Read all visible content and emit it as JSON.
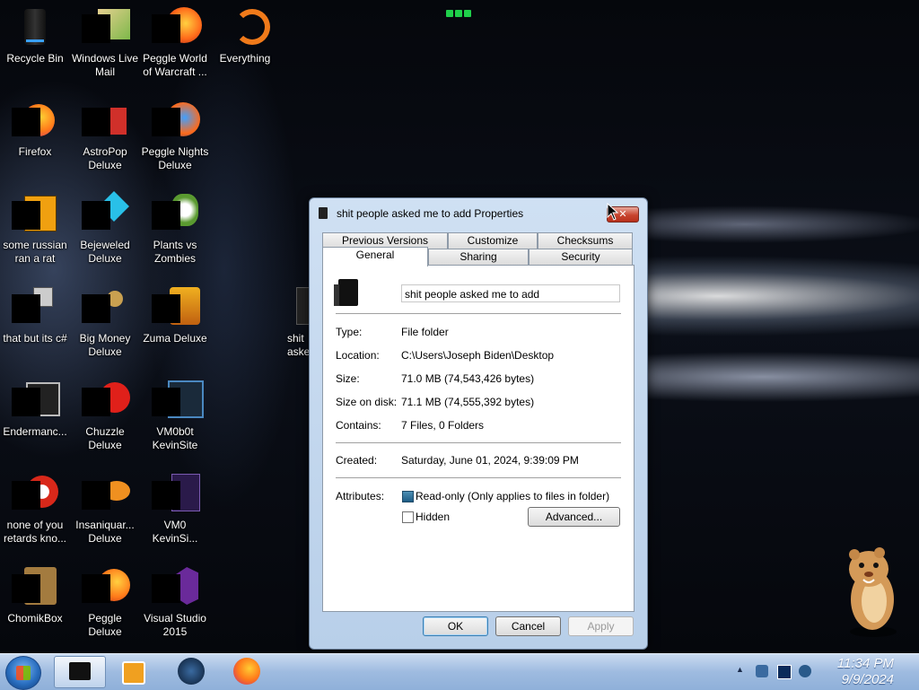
{
  "desktop": {
    "icons": [
      {
        "label": "Recycle Bin"
      },
      {
        "label": "Windows Live\nMail"
      },
      {
        "label": "Peggle World\nof Warcraft ..."
      },
      {
        "label": "Everything"
      },
      {
        "label": "Firefox"
      },
      {
        "label": "AstroPop\nDeluxe"
      },
      {
        "label": "Peggle Nights\nDeluxe"
      },
      {
        "label": "some russian\nran a rat"
      },
      {
        "label": "Bejeweled\nDeluxe"
      },
      {
        "label": "Plants vs\nZombies"
      },
      {
        "label": "that but its c#"
      },
      {
        "label": "Big Money\nDeluxe"
      },
      {
        "label": "Zuma Deluxe"
      },
      {
        "label": "Endermanc..."
      },
      {
        "label": "Chuzzle\nDeluxe"
      },
      {
        "label": "VM0b0t\nKevinSite"
      },
      {
        "label": "none of you\nretards kno..."
      },
      {
        "label": "Insaniquar...\nDeluxe"
      },
      {
        "label": "VM0\nKevinSi..."
      },
      {
        "label": "ChomikBox"
      },
      {
        "label": "Peggle Deluxe"
      },
      {
        "label": "Visual Studio\n2015"
      },
      {
        "label": "shit\naske"
      }
    ]
  },
  "dialog": {
    "title": "shit people asked me to add Properties",
    "close_label": "✕",
    "tabs_top": [
      "Previous Versions",
      "Customize",
      "Checksums"
    ],
    "tabs_bottom": [
      "General",
      "Sharing",
      "Security"
    ],
    "name_value": "shit people asked me to add",
    "rows": [
      {
        "label": "Type:",
        "value": "File folder"
      },
      {
        "label": "Location:",
        "value": "C:\\Users\\Joseph Biden\\Desktop"
      },
      {
        "label": "Size:",
        "value": "71.0 MB (74,543,426 bytes)"
      },
      {
        "label": "Size on disk:",
        "value": "71.1 MB (74,555,392 bytes)"
      },
      {
        "label": "Contains:",
        "value": "7 Files, 0 Folders"
      }
    ],
    "created_label": "Created:",
    "created_value": "Saturday, June 01, 2024, 9:39:09 PM",
    "attributes_label": "Attributes:",
    "readonly_label": "Read-only (Only applies to files in folder)",
    "readonly_checked": true,
    "hidden_label": "Hidden",
    "hidden_checked": false,
    "advanced_label": "Advanced...",
    "ok_label": "OK",
    "cancel_label": "Cancel",
    "apply_label": "Apply"
  },
  "taskbar": {
    "time": "11:34 PM",
    "date": "9/9/2024",
    "show_hidden_icons": "▲"
  }
}
